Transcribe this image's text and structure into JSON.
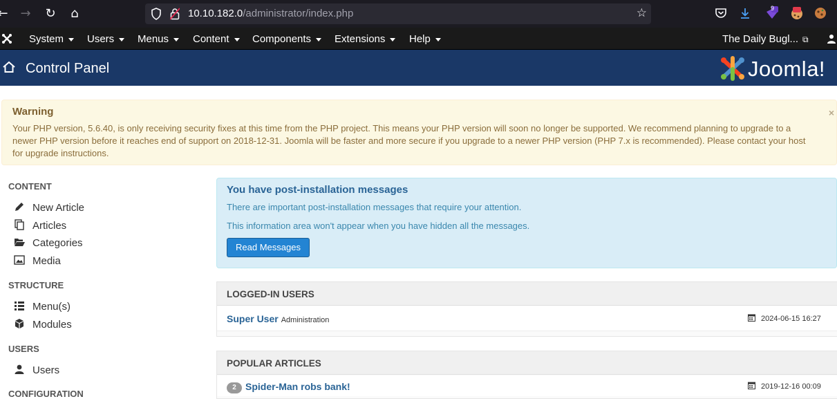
{
  "browser": {
    "url_host": "10.10.182.0",
    "url_path": "/administrator/index.php",
    "back_icon": "←",
    "forward_icon": "→",
    "reload_icon": "↻",
    "home_icon": "⌂",
    "bookmark_icon": "☆",
    "extension_badge": "9"
  },
  "nav": {
    "items": [
      {
        "label": "System"
      },
      {
        "label": "Users"
      },
      {
        "label": "Menus"
      },
      {
        "label": "Content"
      },
      {
        "label": "Components"
      },
      {
        "label": "Extensions"
      },
      {
        "label": "Help"
      }
    ],
    "site_link": "The Daily Bugl...",
    "site_link_icon": "⧉"
  },
  "header": {
    "title": "Control Panel",
    "brand": "Joomla!"
  },
  "warning": {
    "title": "Warning",
    "message": "Your PHP version, 5.6.40, is only receiving security fixes at this time from the PHP project. This means your PHP version will soon no longer be supported. We recommend planning to upgrade to a newer PHP version before it reaches end of support on 2018-12-31. Joomla will be faster and more secure if you upgrade to a newer PHP version (PHP 7.x is recommended). Please contact your host for upgrade instructions.",
    "close": "×"
  },
  "sidebar": {
    "content_heading": "CONTENT",
    "content_items": [
      "New Article",
      "Articles",
      "Categories",
      "Media"
    ],
    "structure_heading": "STRUCTURE",
    "structure_items": [
      "Menu(s)",
      "Modules"
    ],
    "users_heading": "USERS",
    "users_items": [
      "Users"
    ],
    "configuration_heading": "CONFIGURATION"
  },
  "post_install": {
    "title": "You have post-installation messages",
    "line1": "There are important post-installation messages that require your attention.",
    "line2": "This information area won't appear when you have hidden all the messages.",
    "button": "Read Messages"
  },
  "logged_in": {
    "heading": "LOGGED-IN USERS",
    "rows": [
      {
        "name": "Super User",
        "area": "Administration",
        "date": "2024-06-15 16:27"
      }
    ]
  },
  "popular": {
    "heading": "POPULAR ARTICLES",
    "rows": [
      {
        "hits": "2",
        "title": "Spider-Man robs bank!",
        "date": "2019-12-16 00:09"
      }
    ]
  },
  "colors": {
    "header_bg": "#1a3867",
    "nav_bg": "#1a1a1a",
    "warning_bg": "#fcf8e3",
    "info_bg": "#d9edf7",
    "button_bg": "#2384d3",
    "link": "#2a6496"
  }
}
